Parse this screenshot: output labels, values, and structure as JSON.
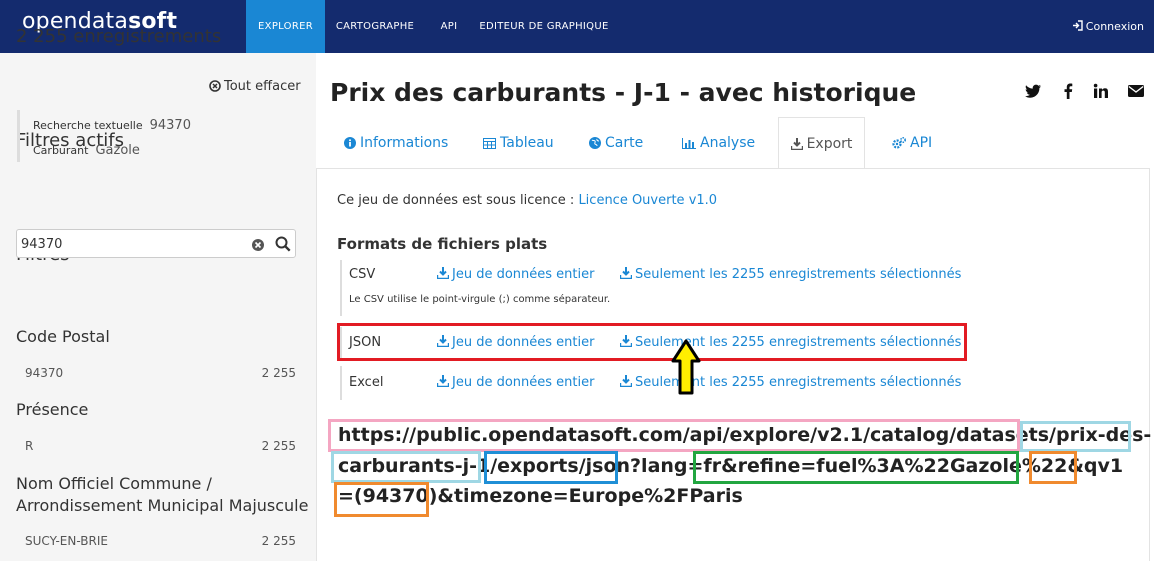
{
  "nav": {
    "logo_light": "opendata",
    "logo_bold": "soft",
    "items": [
      "EXPLORER",
      "CARTOGRAPHE",
      "API",
      "EDITEUR DE GRAPHIQUE"
    ],
    "active_index": 0,
    "login_label": "Connexion",
    "colors": {
      "bar": "#142b6e",
      "active": "#1a87d4"
    }
  },
  "sidebar": {
    "records": "2 255 enregistrements",
    "active_filters_title": "Filtres actifs",
    "clear_all": "Tout effacer",
    "active_filters": [
      {
        "label": "Recherche textuelle",
        "value": "94370"
      },
      {
        "label": "Carburant",
        "value": "Gazole"
      }
    ],
    "filters_title": "Filtres",
    "search_value": "94370",
    "facets": [
      {
        "title": "Code Postal",
        "value": "94370",
        "count": "2 255"
      },
      {
        "title": "Présence",
        "value": "R",
        "count": "2 255"
      },
      {
        "title_line1": "Nom Officiel Commune /",
        "title_line2": "Arrondissement Municipal Majuscule",
        "value": "SUCY-EN-BRIE",
        "count": "2 255"
      }
    ]
  },
  "main": {
    "title": "Prix des carburants - J-1 - avec historique",
    "social_icons": [
      "twitter-icon",
      "facebook-icon",
      "linkedin-icon",
      "email-icon"
    ],
    "tabs": [
      {
        "label": "Informations",
        "icon": "info-icon"
      },
      {
        "label": "Tableau",
        "icon": "table-icon"
      },
      {
        "label": "Carte",
        "icon": "globe-icon"
      },
      {
        "label": "Analyse",
        "icon": "chart-icon"
      },
      {
        "label": "Export",
        "icon": "download-icon"
      },
      {
        "label": "API",
        "icon": "gears-icon"
      }
    ],
    "active_tab": "Export"
  },
  "export": {
    "license_text": "Ce jeu de données est sous licence :",
    "license_link": "Licence Ouverte v1.0",
    "formats_title": "Formats de fichiers plats",
    "full_label": "Jeu de données entier",
    "selected_label": "Seulement les 2255 enregistrements sélectionnés",
    "formats": [
      "CSV",
      "JSON",
      "Excel"
    ],
    "csv_note": "Le CSV utilise le point-virgule (;) comme séparateur."
  },
  "url": {
    "line1": "https://public.opendatasoft.com/api/explore/v2.1/catalog/datasets/prix-des-",
    "line2": "carburants-j-1/exports/json?lang=fr&refine=fuel%3A%22Gazole%22&qv1",
    "line3": "=(94370)&timezone=Europe%2FParis"
  },
  "annotation_colors": {
    "red": "#e21b23",
    "pink": "#f4a6c2",
    "light_blue": "#9fd7e4",
    "blue": "#1f8fd6",
    "green": "#22a640",
    "orange": "#f08a2e",
    "arrow": "#ffee00"
  }
}
